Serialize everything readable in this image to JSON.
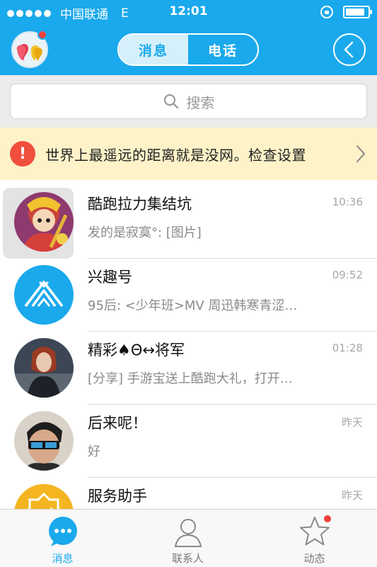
{
  "status_bar": {
    "carrier": "中国联通",
    "network": "E",
    "time": "12:01",
    "battery_level": 0.85
  },
  "navbar": {
    "tabs": [
      {
        "label": "消息",
        "active": true
      },
      {
        "label": "电话",
        "active": false
      }
    ],
    "accent_color": "#1aa9ec"
  },
  "search": {
    "placeholder": "搜索"
  },
  "warning": {
    "text": "世界上最遥远的距离就是没网。检查设置"
  },
  "conversations": [
    {
      "name": "酷跑拉力集结坑",
      "preview": "发的是寂寞°: [图片]",
      "time": "10:36",
      "avatar": "cartoon-warrior"
    },
    {
      "name": "兴趣号",
      "preview": "95后: <少年班>MV 周迅韩寒青涩…",
      "time": "09:52",
      "avatar": "tent-logo"
    },
    {
      "name": "精彩♠Θ↔将军",
      "preview": "[分享] 手游宝送上酷跑大礼，打开…",
      "time": "01:28",
      "avatar": "hero-woman"
    },
    {
      "name": "后来呢！",
      "preview": "好",
      "time": "昨天",
      "avatar": "person-glasses"
    },
    {
      "name": "服务助手",
      "preview": "",
      "time": "昨天",
      "avatar": "service-badge"
    }
  ],
  "tabbar": {
    "tabs": [
      {
        "label": "消息",
        "icon": "chat-bubble-icon",
        "active": true
      },
      {
        "label": "联系人",
        "icon": "contact-icon",
        "active": false
      },
      {
        "label": "动态",
        "icon": "star-icon",
        "active": false,
        "badge": true
      }
    ]
  }
}
